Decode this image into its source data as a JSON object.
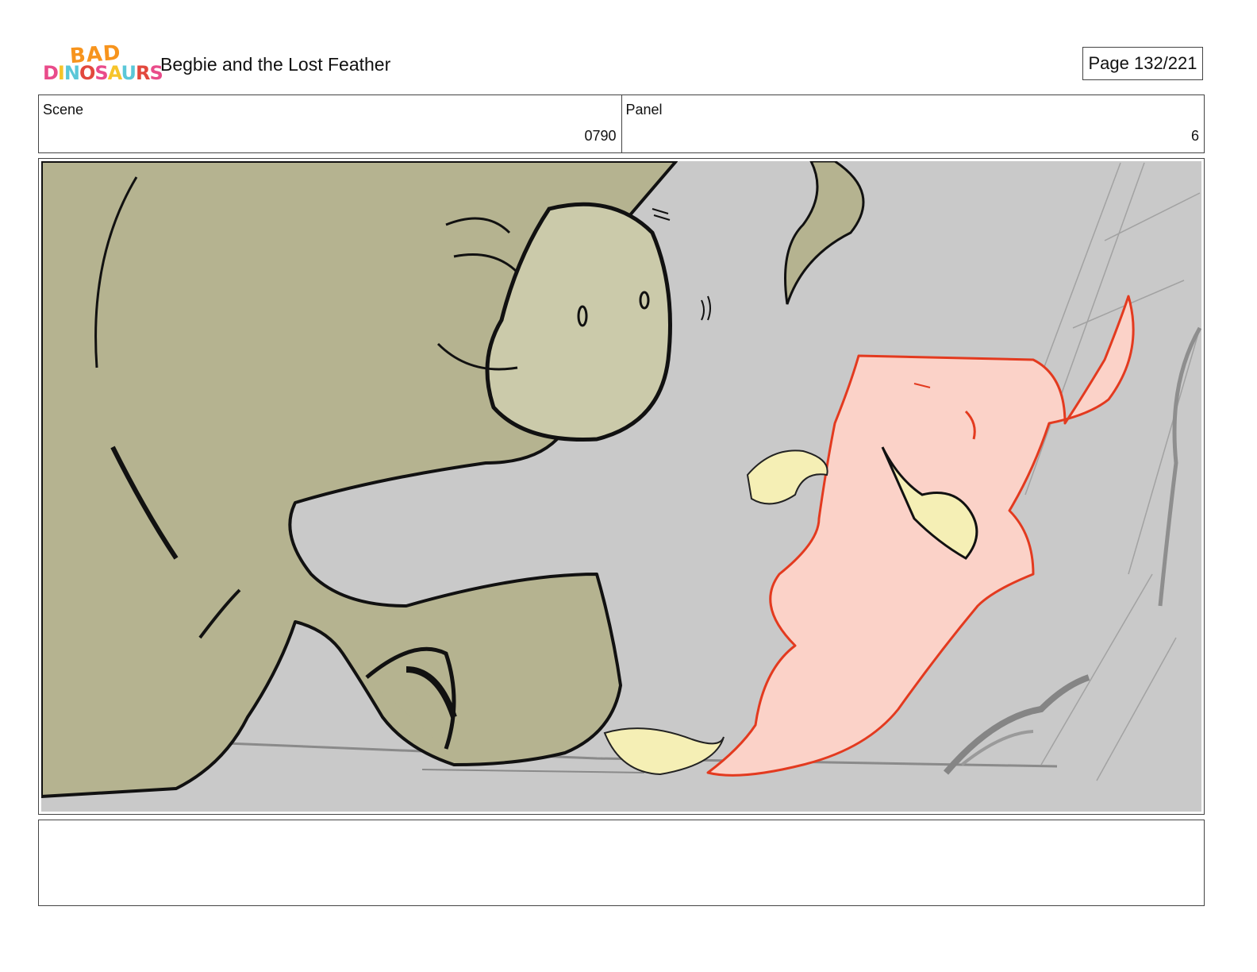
{
  "header": {
    "logo_line1": "BAD",
    "logo_line2": "DINOSAURS",
    "title": "Begbie and the Lost Feather",
    "page": "Page 132/221"
  },
  "info": {
    "scene_label": "Scene",
    "scene_value": "0790",
    "panel_label": "Panel",
    "panel_value": "6"
  },
  "colors": {
    "background": "#c9c9c9",
    "dinosaur": "#b5b390",
    "dinosaur_muzzle": "#cbcaaa",
    "bird": "#fbd2c8",
    "bird_outline": "#e33a1f",
    "feather": "#f5efb5"
  },
  "notes": ""
}
